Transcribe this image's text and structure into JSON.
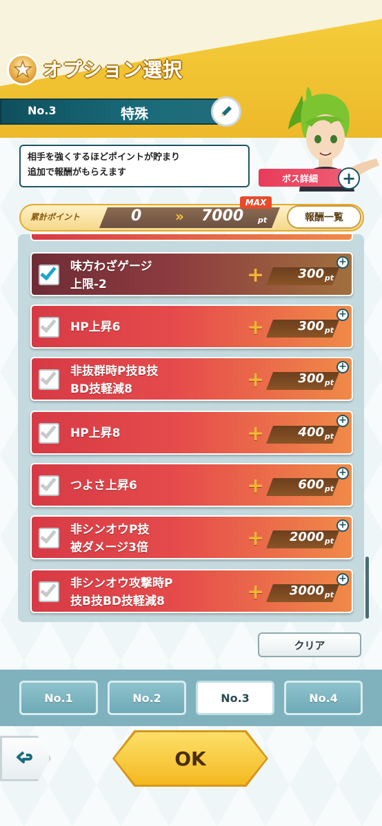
{
  "title": "オプション選択",
  "header": {
    "number": "No.3",
    "label": "特殊"
  },
  "description": [
    "相手を強くするほどポイントが貯まり",
    "追加で報酬がもらえます"
  ],
  "boss_detail_label": "ボス詳細",
  "points": {
    "label": "累計ポイント",
    "current": "0",
    "arrow": "»",
    "max": "7000",
    "unit": "pt",
    "max_tag": "MAX",
    "reward_list_label": "報酬一覧"
  },
  "options": [
    {
      "line1": "味方わざゲージ",
      "line2": "上限-2",
      "cost": "300",
      "selected": true
    },
    {
      "line1": "HP上昇6",
      "line2": "",
      "cost": "300",
      "selected": false
    },
    {
      "line1": "非抜群時P技B技",
      "line2": "BD技軽減8",
      "cost": "300",
      "selected": false
    },
    {
      "line1": "HP上昇8",
      "line2": "",
      "cost": "400",
      "selected": false
    },
    {
      "line1": "つよさ上昇6",
      "line2": "",
      "cost": "600",
      "selected": false
    },
    {
      "line1": "非シンオウP技",
      "line2": "被ダメージ3倍",
      "cost": "2000",
      "selected": false
    },
    {
      "line1": "非シンオウ攻撃時P",
      "line2": "技B技BD技軽減8",
      "cost": "3000",
      "selected": false
    }
  ],
  "cost_unit": "pt",
  "clear_label": "クリア",
  "tabs": [
    "No.1",
    "No.2",
    "No.3",
    "No.4"
  ],
  "active_tab": 2,
  "ok_label": "OK"
}
